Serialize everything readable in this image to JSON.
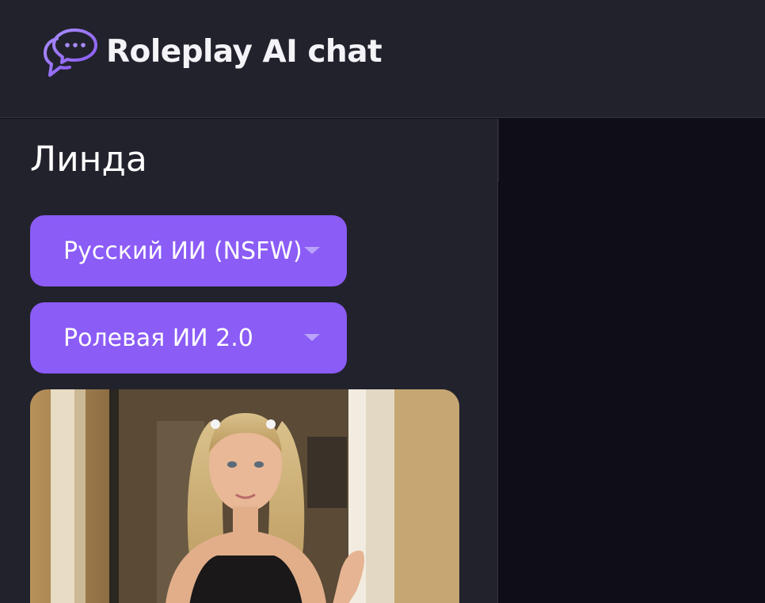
{
  "header": {
    "title": "Roleplay AI chat",
    "logo_icon": "chat-bubbles-icon"
  },
  "sidebar": {
    "character_name": "Линда",
    "language_select": {
      "selected": "Русский ИИ (NSFW)"
    },
    "model_select": {
      "selected": "Ролевая ИИ 2.0"
    },
    "portrait": {
      "alt": "character-portrait"
    }
  },
  "toolbar": {
    "sidebar_toggle_icon": "sidebar-panel-icon"
  },
  "colors": {
    "accent": "#8b5cf6",
    "header_bg": "#22222d",
    "sidebar_bg": "#22222d",
    "main_bg": "#0f0e17"
  }
}
